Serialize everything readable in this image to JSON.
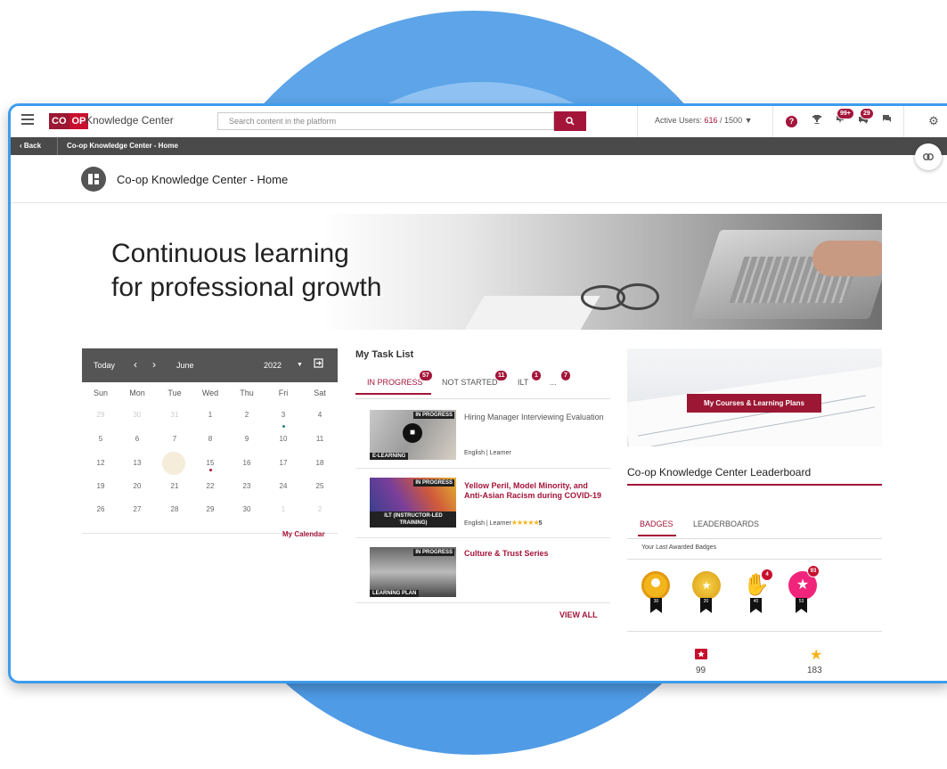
{
  "app": {
    "logo": [
      "CO",
      "OP"
    ],
    "title": "Knowledge Center",
    "search_placeholder": "Search content in the platform",
    "active_users_label": "Active Users: ",
    "active_users_value": "616",
    "active_users_total": " / 1500",
    "badges": {
      "notifications": "99+",
      "messages": "29"
    }
  },
  "breadcrumb": {
    "back": "Back",
    "current": "Co-op Knowledge Center - Home"
  },
  "page": {
    "title": "Co-op Knowledge Center - Home"
  },
  "banner": {
    "line1": "Continuous learning",
    "line2": "for professional growth"
  },
  "calendar": {
    "today_label": "Today",
    "month": "June",
    "year": "2022",
    "days_of_week": [
      "Sun",
      "Mon",
      "Tue",
      "Wed",
      "Thu",
      "Fri",
      "Sat"
    ],
    "weeks": [
      [
        "29",
        "30",
        "31",
        "1",
        "2",
        "3",
        "4"
      ],
      [
        "5",
        "6",
        "7",
        "8",
        "9",
        "10",
        "11"
      ],
      [
        "12",
        "13",
        "14",
        "15",
        "16",
        "17",
        "18"
      ],
      [
        "19",
        "20",
        "21",
        "22",
        "23",
        "24",
        "25"
      ],
      [
        "26",
        "27",
        "28",
        "29",
        "30",
        "1",
        "2"
      ]
    ],
    "my_calendar": "My Calendar"
  },
  "tasks": {
    "title": "My Task List",
    "tabs": [
      {
        "label": "IN PROGRESS",
        "count": "57"
      },
      {
        "label": "NOT STARTED",
        "count": "11"
      },
      {
        "label": "ILT",
        "count": "1"
      },
      {
        "label": "...",
        "count": "7"
      }
    ],
    "items": [
      {
        "status": "IN PROGRESS",
        "type": "E-LEARNING",
        "title": "Hiring Manager Interviewing Evaluation",
        "meta": "English | Learner"
      },
      {
        "status": "IN PROGRESS",
        "type": "ILT (INSTRUCTOR-LED TRAINING)",
        "title": "Yellow Peril, Model Minority, and Anti-Asian Racism during COVID-19",
        "meta": "English | Learner",
        "rating": "5"
      },
      {
        "status": "IN PROGRESS",
        "type": "LEARNING PLAN",
        "title": "Culture & Trust Series",
        "meta": ""
      }
    ],
    "view_all": "VIEW ALL"
  },
  "courses": {
    "button": "My Courses & Learning Plans"
  },
  "leaderboard": {
    "title": "Co-op Knowledge Center Leaderboard",
    "tabs": [
      "BADGES",
      "LEADERBOARDS"
    ],
    "subtitle": "Your Last Awarded Badges",
    "badges": [
      {
        "ribbon": "30",
        "count": ""
      },
      {
        "ribbon": "20",
        "count": ""
      },
      {
        "ribbon": "40",
        "count": "4"
      },
      {
        "ribbon": "53",
        "count": "93"
      }
    ],
    "stats": [
      {
        "icon": "ticket-icon",
        "value": "99"
      },
      {
        "icon": "star-icon",
        "value": "183"
      }
    ]
  },
  "colors": {
    "brand": "#a4153a",
    "accent_blue": "#3d9cec"
  }
}
